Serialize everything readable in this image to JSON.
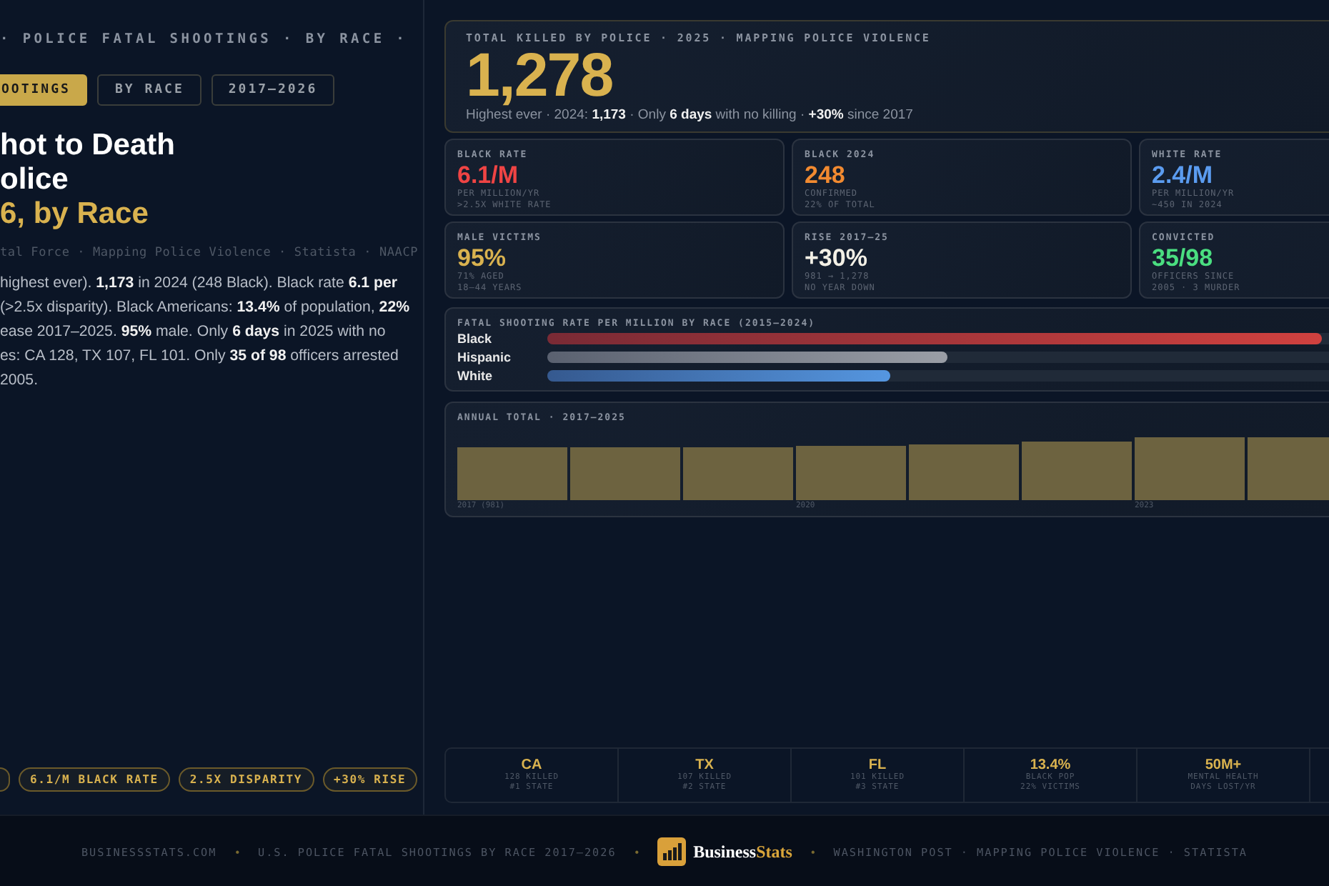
{
  "left": {
    "kicker": "· POLICE FATAL SHOOTINGS · BY RACE ·",
    "tags": [
      {
        "label": "OOTINGS",
        "selected": true
      },
      {
        "label": "BY RACE",
        "selected": false
      },
      {
        "label": "2017–2026",
        "selected": false
      }
    ],
    "title_lines": [
      {
        "text": "hot to Death",
        "accent": false
      },
      {
        "text": "olice",
        "accent": false
      },
      {
        "text": "6, by Race",
        "accent": true
      }
    ],
    "sources": "tal Force · Mapping Police Violence · Statista · NAACP",
    "body_lines": [
      "highest ever). **1,173** in 2024 (248 Black). Black rate **6.1 per**",
      "(>2.5x disparity). Black Americans: **13.4%** of population, **22%**",
      "ease 2017–2025. **95%** male. Only **6 days** in 2025 with no",
      "es: CA 128, TX 107, FL 101. Only **35 of 98** officers arrested",
      "2005."
    ],
    "pills": [
      "6.1/M BLACK RATE",
      "2.5X DISPARITY",
      "+30% RISE"
    ]
  },
  "hero": {
    "label": "TOTAL KILLED BY POLICE · 2025 · MAPPING POLICE VIOLENCE",
    "value": "1,278",
    "note": "Highest ever · 2024: **1,173** · Only **6 days** with no killing · **+30%** since 2017"
  },
  "stats": [
    {
      "label": "BLACK RATE",
      "value": "6.1/M",
      "color": "#ef4444",
      "sub": [
        "PER MILLION/YR",
        ">2.5X WHITE RATE"
      ]
    },
    {
      "label": "BLACK 2024",
      "value": "248",
      "color": "#f28a30",
      "sub": [
        "CONFIRMED",
        "22% OF TOTAL"
      ]
    },
    {
      "label": "WHITE RATE",
      "value": "2.4/M",
      "color": "#5b9cf0",
      "sub": [
        "PER MILLION/YR",
        "~450 IN 2024"
      ]
    },
    {
      "label": "MALE VICTIMS",
      "value": "95%",
      "color": "#d9b24f",
      "sub": [
        "71% AGED",
        "18–44 YEARS"
      ]
    },
    {
      "label": "RISE 2017–25",
      "value": "+30%",
      "color": "#f3f0e6",
      "sub": [
        "981 → 1,278",
        "NO YEAR DOWN"
      ]
    },
    {
      "label": "CONVICTED",
      "value": "35/98",
      "color": "#4ade80",
      "sub": [
        "OFFICERS SINCE",
        "2005 · 3 MURDER"
      ]
    }
  ],
  "rate_bars": {
    "title": "FATAL SHOOTING RATE PER MILLION BY RACE (2015–2024)",
    "rows": [
      {
        "label": "Black",
        "level": 0.97,
        "kind": "red"
      },
      {
        "label": "Hispanic",
        "level": 0.5,
        "kind": "grey"
      },
      {
        "label": "White",
        "level": 0.43,
        "kind": "blue"
      }
    ]
  },
  "annual": {
    "title": "ANNUAL TOTAL · 2017–2025",
    "axis_labels": [
      "2017 (981)",
      "2020",
      "2023"
    ]
  },
  "strip": [
    {
      "value": "CA",
      "sub": [
        "128 KILLED",
        "#1 STATE"
      ]
    },
    {
      "value": "TX",
      "sub": [
        "107 KILLED",
        "#2 STATE"
      ]
    },
    {
      "value": "FL",
      "sub": [
        "101 KILLED",
        "#3 STATE"
      ]
    },
    {
      "value": "13.4%",
      "sub": [
        "BLACK POP",
        "22% VICTIMS"
      ]
    },
    {
      "value": "50M+",
      "sub": [
        "MENTAL HEALTH",
        "DAYS LOST/YR"
      ]
    }
  ],
  "footer": [
    {
      "kind": "link",
      "text": "BUSINESSSTATS.COM"
    },
    {
      "kind": "dot",
      "text": "•"
    },
    {
      "kind": "text",
      "text": "U.S. POLICE FATAL SHOOTINGS BY RACE 2017–2026"
    },
    {
      "kind": "dot",
      "text": "•"
    },
    {
      "kind": "logo",
      "parts": [
        "Business",
        "Stats"
      ]
    },
    {
      "kind": "dot",
      "text": "•"
    },
    {
      "kind": "text",
      "text": "WASHINGTON POST · MAPPING POLICE VIOLENCE · STATISTA"
    }
  ]
}
